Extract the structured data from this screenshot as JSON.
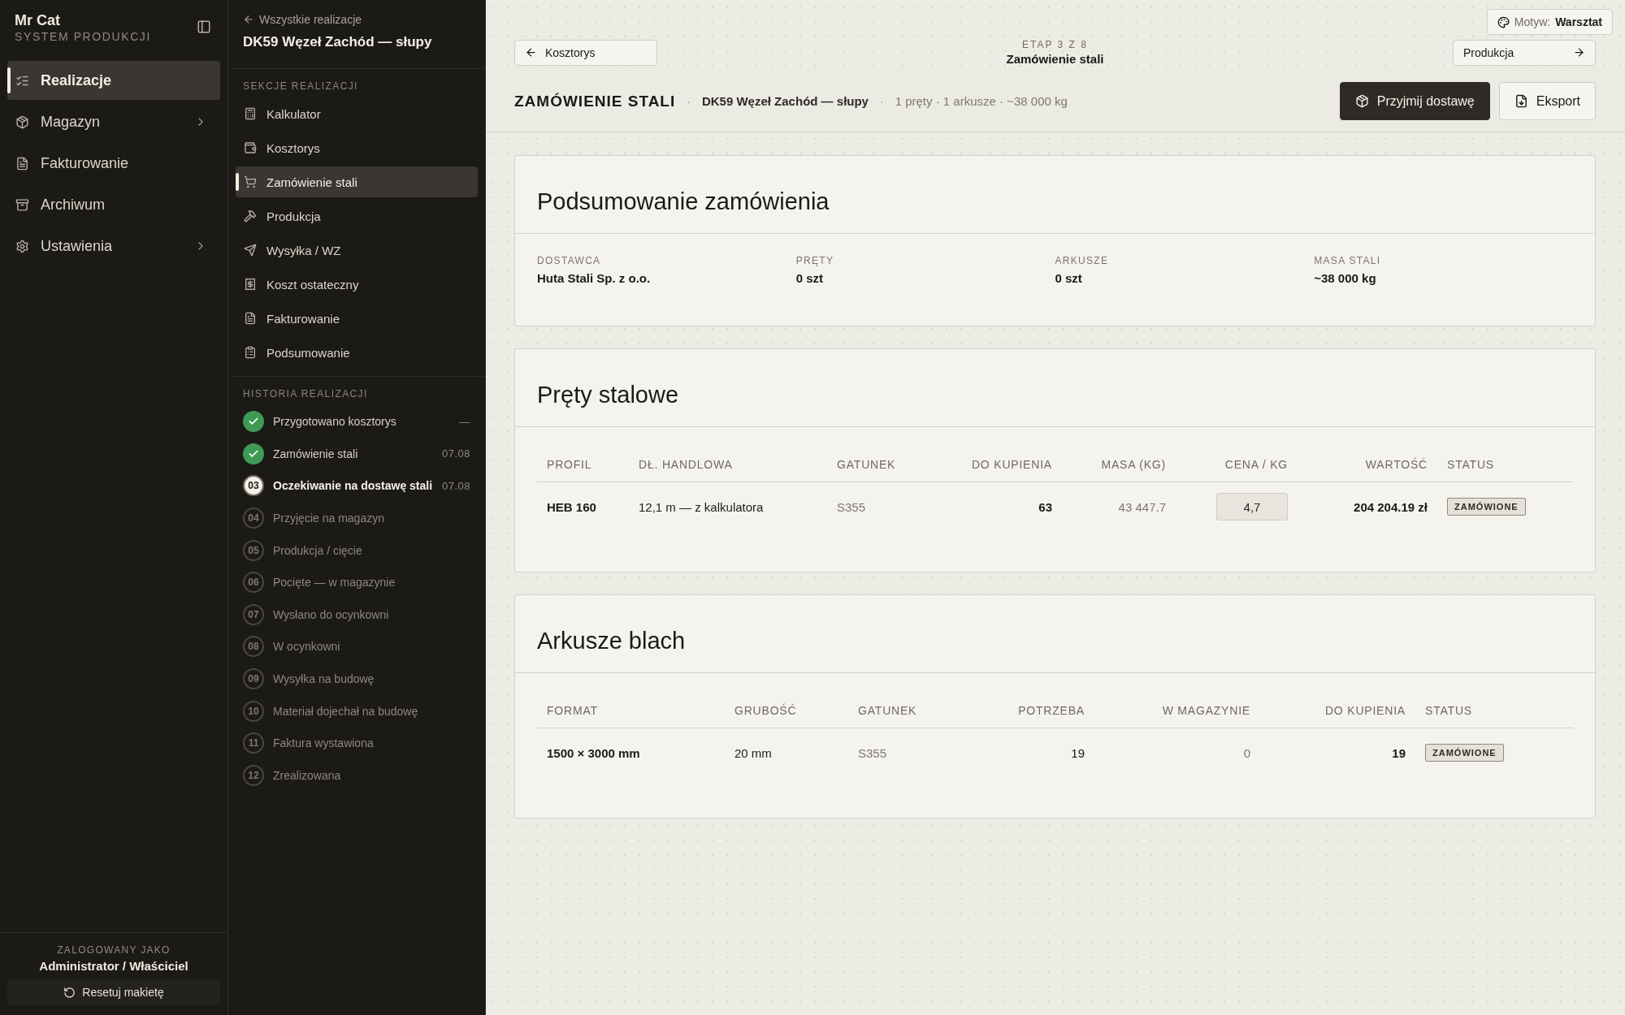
{
  "sidebar": {
    "brand": "Mr Cat",
    "subtitle": "SYSTEM PRODUKCJI",
    "items": [
      {
        "label": "Realizacje",
        "selected": true,
        "has_submenu": false
      },
      {
        "label": "Magazyn",
        "selected": false,
        "has_submenu": true
      },
      {
        "label": "Fakturowanie",
        "selected": false,
        "has_submenu": false
      },
      {
        "label": "Archiwum",
        "selected": false,
        "has_submenu": false
      },
      {
        "label": "Ustawienia",
        "selected": false,
        "has_submenu": true
      }
    ],
    "user_label": "ZALOGOWANY JAKO",
    "user": "Administrator / Właściciel",
    "reset_button": "Resetuj makietę"
  },
  "project_panel": {
    "back_link": "Wszystkie realizacje",
    "title": "DK59 Węzeł Zachód — słupy",
    "sections_label": "SEKCJE REALIZACJI",
    "sections": [
      {
        "label": "Kalkulator",
        "selected": false
      },
      {
        "label": "Kosztorys",
        "selected": false
      },
      {
        "label": "Zamówienie stali",
        "selected": true
      },
      {
        "label": "Produkcja",
        "selected": false
      },
      {
        "label": "Wysyłka / WZ",
        "selected": false
      },
      {
        "label": "Koszt ostateczny",
        "selected": false
      },
      {
        "label": "Fakturowanie",
        "selected": false
      },
      {
        "label": "Podsumowanie",
        "selected": false
      }
    ],
    "history_label": "HISTORIA REALIZACJI",
    "history": [
      {
        "label": "Przygotowano kosztorys",
        "done": true,
        "current": false,
        "date": "—"
      },
      {
        "label": "Zamówienie stali",
        "done": true,
        "current": false,
        "date": "07.08"
      },
      {
        "number": "03",
        "label": "Oczekiwanie na dostawę stali",
        "done": false,
        "current": true,
        "date": "07.08"
      },
      {
        "number": "04",
        "label": "Przyjęcie na magazyn",
        "done": false,
        "current": false
      },
      {
        "number": "05",
        "label": "Produkcja / cięcie",
        "done": false,
        "current": false
      },
      {
        "number": "06",
        "label": "Pocięte — w magazynie",
        "done": false,
        "current": false
      },
      {
        "number": "07",
        "label": "Wysłano do ocynkowni",
        "done": false,
        "current": false
      },
      {
        "number": "08",
        "label": "W ocynkowni",
        "done": false,
        "current": false
      },
      {
        "number": "09",
        "label": "Wysyłka na budowę",
        "done": false,
        "current": false
      },
      {
        "number": "10",
        "label": "Materiał dojechał na budowę",
        "done": false,
        "current": false
      },
      {
        "number": "11",
        "label": "Faktura wystawiona",
        "done": false,
        "current": false
      },
      {
        "number": "12",
        "label": "Zrealizowana",
        "done": false,
        "current": false
      }
    ]
  },
  "main": {
    "theme": {
      "label": "Motyw:",
      "value": "Warsztat"
    },
    "prev_button": "Kosztorys",
    "step": "ETAP 3 Z 8",
    "step_title": "Zamówienie stali",
    "next_button": "Produkcja",
    "page_title": "ZAMÓWIENIE STALI",
    "separators": [
      "·",
      "·"
    ],
    "project": "DK59 Węzeł Zachód — słupy",
    "meta": "1 pręty · 1 arkusze · ~38 000 kg",
    "actions": [
      {
        "label": "Przyjmij dostawę",
        "kind": "primary"
      },
      {
        "label": "Eksport",
        "kind": "secondary"
      }
    ],
    "summary": {
      "title": "Podsumowanie zamówienia",
      "fields": [
        {
          "label": "DOSTAWCA",
          "value": "Huta Stali Sp. z o.o."
        },
        {
          "label": "PRĘTY",
          "value": "0 szt"
        },
        {
          "label": "ARKUSZE",
          "value": "0 szt"
        },
        {
          "label": "MASA STALI",
          "value": "~38 000 kg"
        }
      ]
    },
    "tables": [
      {
        "title": "Pręty stalowe",
        "columns": [
          "PROFIL",
          "DŁ. HANDLOWA",
          "GATUNEK",
          "DO KUPIENIA",
          "MASA (KG)",
          "CENA / KG",
          "WARTOŚĆ",
          "STATUS"
        ],
        "rows": [
          [
            {
              "kind": "strong",
              "text": "HEB 160"
            },
            {
              "kind": "text",
              "text": "12,1 m — z kalkulatora"
            },
            {
              "kind": "muted",
              "text": "S355"
            },
            {
              "kind": "strong",
              "text": "63"
            },
            {
              "kind": "muted",
              "text": "43 447.7"
            },
            {
              "kind": "input",
              "text": "4,7"
            },
            {
              "kind": "strong",
              "text": "204 204.19 zł"
            },
            {
              "kind": "badge",
              "text": "ZAMÓWIONE"
            }
          ]
        ]
      },
      {
        "title": "Arkusze blach",
        "columns": [
          "FORMAT",
          "GRUBOŚĆ",
          "GATUNEK",
          "POTRZEBA",
          "W MAGAZYNIE",
          "DO KUPIENIA",
          "STATUS"
        ],
        "rows": [
          [
            {
              "kind": "strong",
              "text": "1500 × 3000 mm"
            },
            {
              "kind": "text",
              "text": "20 mm"
            },
            {
              "kind": "muted",
              "text": "S355"
            },
            {
              "kind": "text",
              "text": "19"
            },
            {
              "kind": "muted",
              "text": "0"
            },
            {
              "kind": "strong",
              "text": "19"
            },
            {
              "kind": "badge",
              "text": "ZAMÓWIONE"
            }
          ]
        ]
      }
    ]
  }
}
